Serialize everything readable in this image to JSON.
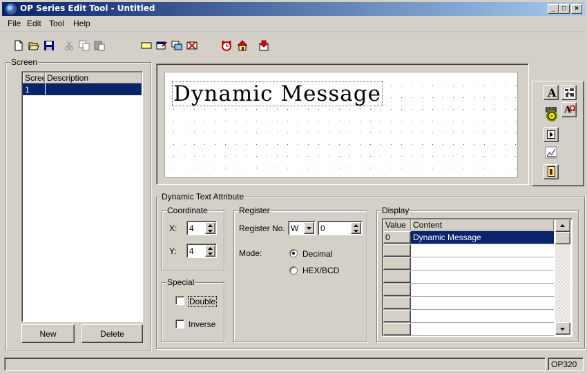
{
  "window": {
    "title": "OP Series Edit Tool - Untitled"
  },
  "menu": [
    "File",
    "Edit",
    "Tool",
    "Help"
  ],
  "toolbar": {
    "icons": [
      "new-file-icon",
      "open-folder-icon",
      "save-icon",
      "cut-icon",
      "copy-icon",
      "paste-icon",
      "add-screen-icon",
      "screen-properties-icon",
      "copy-screen-icon",
      "delete-screen-icon",
      "alarm-clock-icon",
      "home-icon",
      "download-icon"
    ]
  },
  "screen_panel": {
    "group_label": "Screen",
    "columns": [
      "Scree",
      "Description"
    ],
    "rows": [
      {
        "no": "1",
        "description": ""
      }
    ],
    "new_label": "New",
    "delete_label": "Delete"
  },
  "canvas": {
    "message": "Dynamic Message"
  },
  "attributes": {
    "group_label": "Dynamic Text Attribute",
    "coordinate": {
      "label": "Coordinate",
      "x_label": "X:",
      "x_value": "4",
      "y_label": "Y:",
      "y_value": "4"
    },
    "special": {
      "label": "Special",
      "double_label": "Double",
      "inverse_label": "Inverse"
    },
    "register": {
      "label": "Register",
      "reg_no_label": "Register No.",
      "reg_type": "W",
      "reg_value": "0",
      "mode_label": "Mode:",
      "decimal_label": "Decimal",
      "hex_label": "HEX/BCD",
      "selected_mode": "Decimal"
    },
    "display": {
      "label": "Display",
      "columns": [
        "Value",
        "Content"
      ],
      "rows": [
        {
          "value": "0",
          "content": "Dynamic Message"
        }
      ]
    }
  },
  "statusbar": {
    "model": "OP320"
  },
  "colors": {
    "face": "#d4d0c8",
    "selection": "#0a246a",
    "title_start": "#0a246a",
    "title_end": "#a6caf0"
  }
}
